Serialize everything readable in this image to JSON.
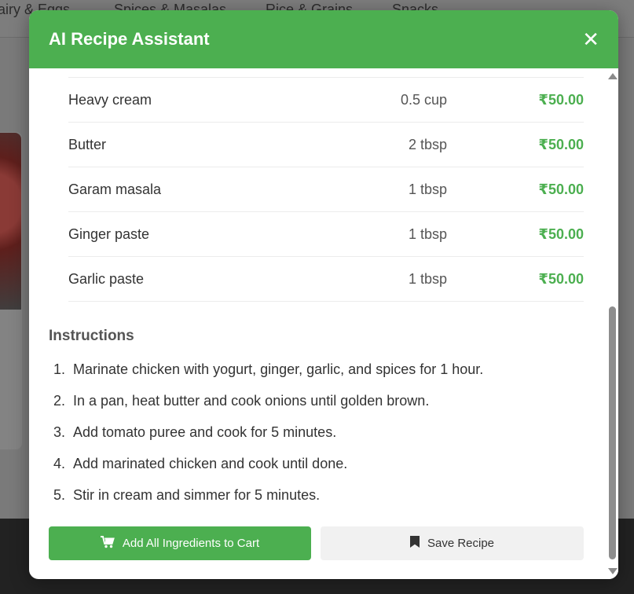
{
  "background": {
    "nav_items": [
      "airy & Eggs",
      "Spices & Masalas",
      "Rice & Grains",
      "Snacks"
    ]
  },
  "modal": {
    "title": "AI Recipe Assistant",
    "close_glyph": "✕",
    "ingredients": [
      {
        "name": "Heavy cream",
        "qty": "0.5 cup",
        "price": "₹50.00"
      },
      {
        "name": "Butter",
        "qty": "2 tbsp",
        "price": "₹50.00"
      },
      {
        "name": "Garam masala",
        "qty": "1 tbsp",
        "price": "₹50.00"
      },
      {
        "name": "Ginger paste",
        "qty": "1 tbsp",
        "price": "₹50.00"
      },
      {
        "name": "Garlic paste",
        "qty": "1 tbsp",
        "price": "₹50.00"
      }
    ],
    "instructions_heading": "Instructions",
    "instructions": [
      {
        "num": "1.",
        "text": "Marinate chicken with yogurt, ginger, garlic, and spices for 1 hour."
      },
      {
        "num": "2.",
        "text": "In a pan, heat butter and cook onions until golden brown."
      },
      {
        "num": "3.",
        "text": "Add tomato puree and cook for 5 minutes."
      },
      {
        "num": "4.",
        "text": "Add marinated chicken and cook until done."
      },
      {
        "num": "5.",
        "text": "Stir in cream and simmer for 5 minutes."
      }
    ],
    "add_to_cart_label": "Add All Ingredients to Cart",
    "save_recipe_label": "Save Recipe"
  },
  "icons": {
    "cart": "cart-icon",
    "bookmark": "bookmark-icon",
    "close": "close-icon"
  },
  "colors": {
    "accent": "#4caf50",
    "price": "#4caf50"
  }
}
